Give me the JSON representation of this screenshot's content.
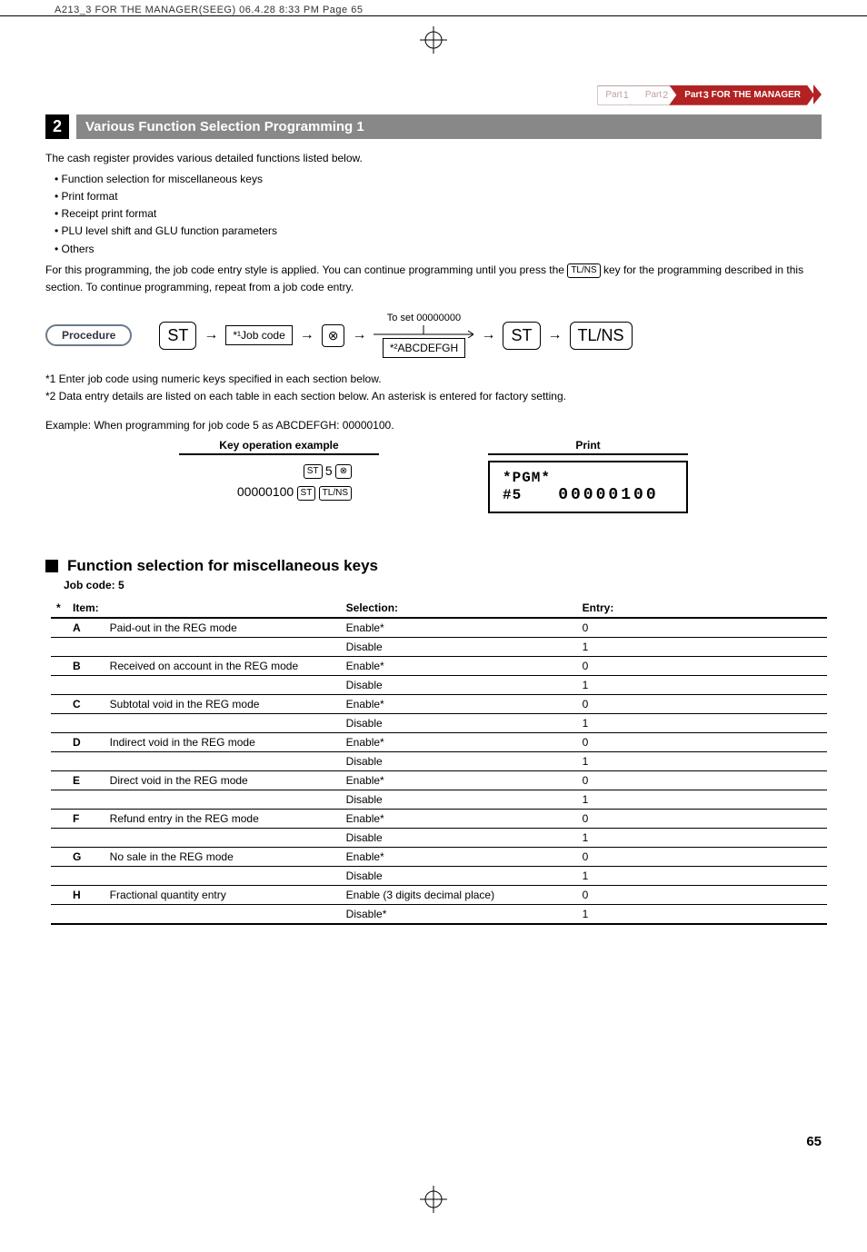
{
  "header": "A213_3 FOR THE MANAGER(SEEG)  06.4.28 8:33 PM  Page 65",
  "crumbs": {
    "p1": "Part",
    "n1": "1",
    "p2": "Part",
    "n2": "2",
    "p3": "Part",
    "n3": "3",
    "p3label": "FOR THE MANAGER"
  },
  "sec": {
    "num": "2",
    "title": "Various Function Selection Programming 1"
  },
  "intro": "The cash register provides various detailed functions listed below.",
  "bullets": {
    "a": "Function selection for miscellaneous keys",
    "b": "Print format",
    "c": "Receipt print format",
    "d": "PLU level shift and GLU function parameters",
    "e": "Others"
  },
  "para1a": "For this programming, the job code entry style is applied.  You can continue programming until you press the ",
  "para1b": " key for the programming described in this section.  To continue programming, repeat from a job code entry.",
  "tlns": "TL/NS",
  "proc": {
    "label": "Procedure",
    "st": "ST",
    "jobcode": "*¹Job code",
    "x": "⊗",
    "toset": "To set  00000000",
    "abcdefgh": "*²ABCDEFGH",
    "tlns": "TL/NS"
  },
  "note1": "*1  Enter job code using numeric keys specified in each section below.",
  "note2": "*2  Data entry details are listed on each table in each section below.  An asterisk is entered for factory setting.",
  "example": "Example:  When programming for job code 5 as ABCDEFGH: 00000100.",
  "exHead1": "Key operation example",
  "exHead2": "Print",
  "ex": {
    "st": "ST",
    "five": "5",
    "x": "⊗",
    "code": "00000100",
    "tlns": "TL/NS"
  },
  "print": {
    "r1": "*PGM*",
    "r2a": "#5",
    "r2b": "00000100"
  },
  "sub": {
    "title": "Function selection for miscellaneous keys",
    "job": "Job code:  5"
  },
  "th": {
    "item": "Item:",
    "sel": "Selection:",
    "ent": "Entry:"
  },
  "rows": {
    "a": {
      "k": "A",
      "d": "Paid-out in the REG mode",
      "s0": "Enable*",
      "e0": "0",
      "s1": "Disable",
      "e1": "1"
    },
    "b": {
      "k": "B",
      "d": "Received on account in the REG mode",
      "s0": "Enable*",
      "e0": "0",
      "s1": "Disable",
      "e1": "1"
    },
    "c": {
      "k": "C",
      "d": "Subtotal void in the REG mode",
      "s0": "Enable*",
      "e0": "0",
      "s1": "Disable",
      "e1": "1"
    },
    "d": {
      "k": "D",
      "d": "Indirect void in the REG mode",
      "s0": "Enable*",
      "e0": "0",
      "s1": "Disable",
      "e1": "1"
    },
    "e": {
      "k": "E",
      "d": "Direct void in the REG mode",
      "s0": "Enable*",
      "e0": "0",
      "s1": "Disable",
      "e1": "1"
    },
    "f": {
      "k": "F",
      "d": "Refund entry in the REG mode",
      "s0": "Enable*",
      "e0": "0",
      "s1": "Disable",
      "e1": "1"
    },
    "g": {
      "k": "G",
      "d": "No sale in the REG mode",
      "s0": "Enable*",
      "e0": "0",
      "s1": "Disable",
      "e1": "1"
    },
    "h": {
      "k": "H",
      "d": "Fractional quantity entry",
      "s0": "Enable (3 digits decimal place)",
      "e0": "0",
      "s1": "Disable*",
      "e1": "1"
    }
  },
  "pgnum": "65"
}
